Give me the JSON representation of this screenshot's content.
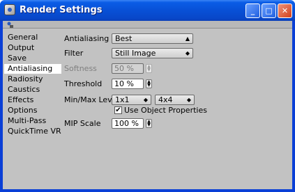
{
  "window": {
    "title": "Render Settings"
  },
  "sidebar": {
    "items": [
      {
        "label": "General",
        "active": false
      },
      {
        "label": "Output",
        "active": false
      },
      {
        "label": "Save",
        "active": false
      },
      {
        "label": "Antialiasing",
        "active": true
      },
      {
        "label": "Radiosity",
        "active": false
      },
      {
        "label": "Caustics",
        "active": false
      },
      {
        "label": "Effects",
        "active": false
      },
      {
        "label": "Options",
        "active": false
      },
      {
        "label": "Multi-Pass",
        "active": false
      },
      {
        "label": "QuickTime VR",
        "active": false
      }
    ]
  },
  "settings": {
    "antialiasing": {
      "label": "Antialiasing",
      "value": "Best"
    },
    "filter": {
      "label": "Filter",
      "value": "Still Image"
    },
    "softness": {
      "label": "Softness",
      "value": "50 %"
    },
    "threshold": {
      "label": "Threshold",
      "value": "10 %"
    },
    "minmax": {
      "label": "Min/Max Level",
      "min": "1x1",
      "max": "4x4"
    },
    "use_object_properties": {
      "label": "Use Object Properties",
      "checked": true
    },
    "mip_scale": {
      "label": "MIP Scale",
      "value": "100 %"
    }
  },
  "icons": {
    "spinner": "▲▼",
    "dropdown": "▲▼",
    "check": "✔"
  }
}
